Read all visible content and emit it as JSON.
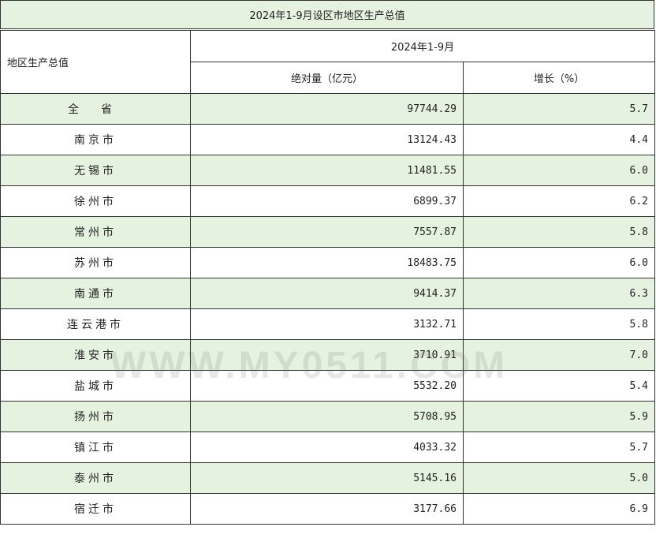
{
  "title": "2024年1-9月设区市地区生产总值",
  "header": {
    "region_col": "地区生产总值",
    "period": "2024年1-9月",
    "col_value": "绝对量（亿元）",
    "col_growth": "增长（%）"
  },
  "rows": [
    {
      "region": "全省",
      "value": "97744.29",
      "growth": "5.7"
    },
    {
      "region": "南京市",
      "value": "13124.43",
      "growth": "4.4"
    },
    {
      "region": "无锡市",
      "value": "11481.55",
      "growth": "6.0"
    },
    {
      "region": "徐州市",
      "value": "6899.37",
      "growth": "6.2"
    },
    {
      "region": "常州市",
      "value": "7557.87",
      "growth": "5.8"
    },
    {
      "region": "苏州市",
      "value": "18483.75",
      "growth": "6.0"
    },
    {
      "region": "南通市",
      "value": "9414.37",
      "growth": "6.3"
    },
    {
      "region": "连云港市",
      "value": "3132.71",
      "growth": "5.8"
    },
    {
      "region": "淮安市",
      "value": "3710.91",
      "growth": "7.0"
    },
    {
      "region": "盐城市",
      "value": "5532.20",
      "growth": "5.4"
    },
    {
      "region": "扬州市",
      "value": "5708.95",
      "growth": "5.9"
    },
    {
      "region": "镇江市",
      "value": "4033.32",
      "growth": "5.7"
    },
    {
      "region": "泰州市",
      "value": "5145.16",
      "growth": "5.0"
    },
    {
      "region": "宿迁市",
      "value": "3177.66",
      "growth": "6.9"
    }
  ],
  "watermark": "WWW.MY0511.COM",
  "colors": {
    "shade": "#e6f2e0",
    "border": "#333333"
  }
}
